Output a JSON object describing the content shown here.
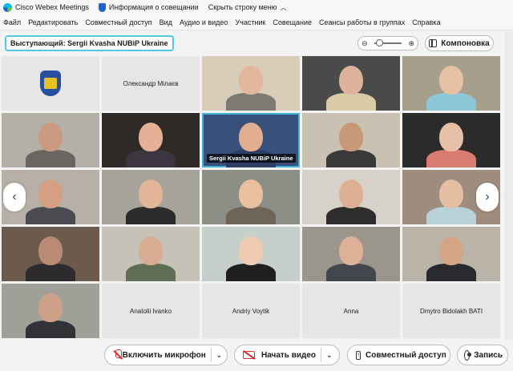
{
  "titlebar": {
    "app_name": "Cisco Webex Meetings",
    "meeting_info": "Информация о совещании",
    "hide_menu": "Скрыть строку меню"
  },
  "menu": [
    "Файл",
    "Редактировать",
    "Совместный доступ",
    "Вид",
    "Аудио и видео",
    "Участник",
    "Совещание",
    "Сеансы работы в группах",
    "Справка"
  ],
  "speaker": {
    "label": "Выступающий: Sergii Kvasha NUBiP Ukraine"
  },
  "layout_button": {
    "label": "Компоновка"
  },
  "tiles": [
    {
      "type": "logo"
    },
    {
      "type": "name",
      "name": "Олександр Мілаєв"
    },
    {
      "type": "video",
      "bg": "#d8cdb8",
      "skin": "#e3b79b",
      "shirt": "#7d7a74"
    },
    {
      "type": "video",
      "bg": "#4a4a4a",
      "skin": "#ddb39b",
      "shirt": "#d9cba8"
    },
    {
      "type": "video",
      "bg": "#a59f8c",
      "skin": "#e6c1a6",
      "shirt": "#8cc7d8"
    },
    {
      "type": "video",
      "bg": "#b3b0a8",
      "skin": "#c99a80",
      "shirt": "#6a6560"
    },
    {
      "type": "video",
      "bg": "#2f2a28",
      "skin": "#e4b096",
      "shirt": "#3b3640"
    },
    {
      "type": "video",
      "bg": "#38507a",
      "skin": "#e1ae92",
      "shirt": "#2e3d66",
      "active": true,
      "caption": "Sergii Kvasha NUBiP Ukraine"
    },
    {
      "type": "video",
      "bg": "#c9c1b2",
      "skin": "#c99879",
      "shirt": "#3a3a3a"
    },
    {
      "type": "video",
      "bg": "#2b2b2b",
      "skin": "#e7bea6",
      "shirt": "#d97b6e"
    },
    {
      "type": "video",
      "bg": "#b7b0a6",
      "skin": "#d49f82",
      "shirt": "#4b4b52"
    },
    {
      "type": "video",
      "bg": "#a7a49c",
      "skin": "#e2b598",
      "shirt": "#2c2c2c"
    },
    {
      "type": "video",
      "bg": "#8b8f86",
      "skin": "#e8c0a0",
      "shirt": "#6f6458"
    },
    {
      "type": "video",
      "bg": "#d7d2c9",
      "skin": "#ddaf93",
      "shirt": "#2d2d2d"
    },
    {
      "type": "video",
      "bg": "#9e8d7c",
      "skin": "#e5bea4",
      "shirt": "#b7d2d8"
    },
    {
      "type": "video",
      "bg": "#6c5a4c",
      "skin": "#b98a74",
      "shirt": "#2d2b2d"
    },
    {
      "type": "video",
      "bg": "#c7c2b8",
      "skin": "#d9ad94",
      "shirt": "#5e6e54"
    },
    {
      "type": "video",
      "bg": "#c6cfc9",
      "skin": "#f0cbb2",
      "shirt": "#1f1f22"
    },
    {
      "type": "video",
      "bg": "#9a968c",
      "skin": "#dcb197",
      "shirt": "#44464e"
    },
    {
      "type": "video",
      "bg": "#bab4a8",
      "skin": "#d3a585",
      "shirt": "#292a2e"
    },
    {
      "type": "video",
      "bg": "#9fa199",
      "skin": "#cda189",
      "shirt": "#303236"
    },
    {
      "type": "name",
      "name": "Anatolii Ivanko"
    },
    {
      "type": "name",
      "name": "Andriy Voytik"
    },
    {
      "type": "name",
      "name": "Anna"
    },
    {
      "type": "name",
      "name": "Dmytro Bidolakh BATI"
    }
  ],
  "controls": {
    "mic": "Включить микрофон",
    "video": "Начать видео",
    "share": "Совместный доступ",
    "record": "Запись"
  },
  "colors": {
    "active_border": "#3fb3dd",
    "muted_icon": "#d72d2d"
  }
}
